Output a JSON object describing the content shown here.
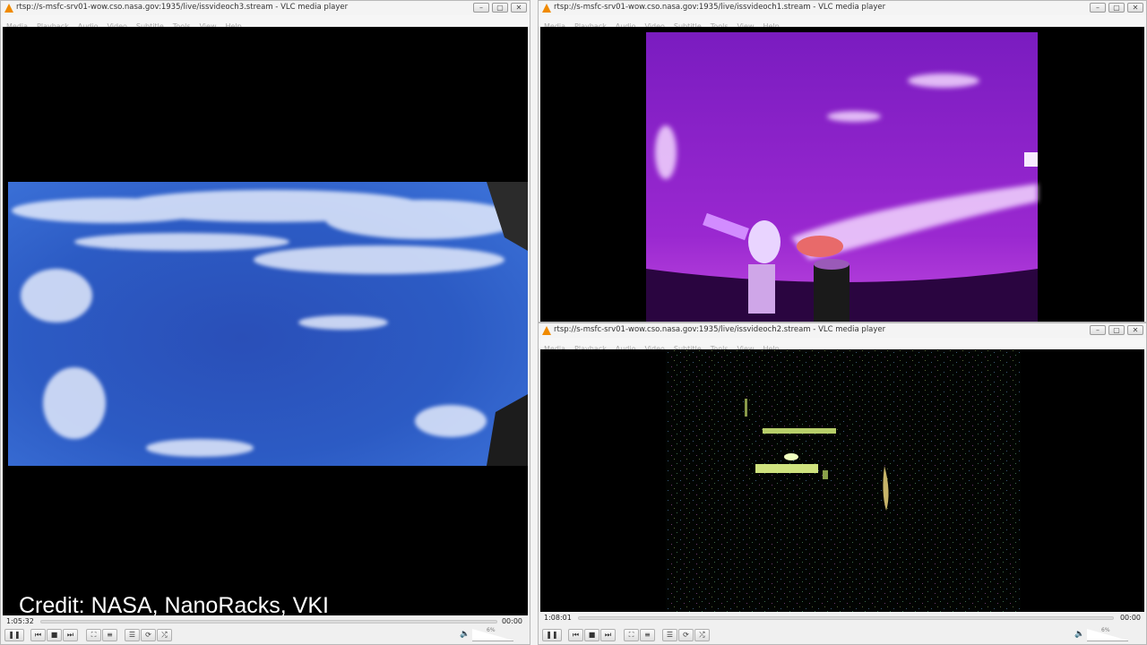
{
  "menu": [
    "Media",
    "Playback",
    "Audio",
    "Video",
    "Subtitle",
    "Tools",
    "View",
    "Help"
  ],
  "window_buttons": {
    "minimize": "–",
    "maximize": "▢",
    "close": "✕"
  },
  "windows": {
    "left": {
      "title": "rtsp://s-msfc-srv01-wow.cso.nasa.gov:1935/live/issvideoch3.stream - VLC media player",
      "elapsed": "1:05:32",
      "total": "00:00",
      "volume": "6%"
    },
    "top_right": {
      "title": "rtsp://s-msfc-srv01-wow.cso.nasa.gov:1935/live/issvideoch1.stream - VLC media player"
    },
    "bottom_right": {
      "title": "rtsp://s-msfc-srv01-wow.cso.nasa.gov:1935/live/issvideoch2.stream - VLC media player",
      "elapsed": "1:08:01",
      "total": "00:00",
      "volume": "6%"
    }
  },
  "controls": {
    "pause": "❚❚",
    "prev": "⏮",
    "stop": "■",
    "next": "⏭",
    "fullscreen": "⛶",
    "extended": "≡",
    "playlist": "☰",
    "loop": "⟳",
    "random": "⤮"
  },
  "credit": "Credit: NASA, NanoRacks, VKI",
  "colors": {
    "vlc_orange": "#f08a00",
    "earth_blue": "#2a52b8",
    "earth_magenta": "#8a1fc4",
    "night_green": "#c9e07a"
  }
}
